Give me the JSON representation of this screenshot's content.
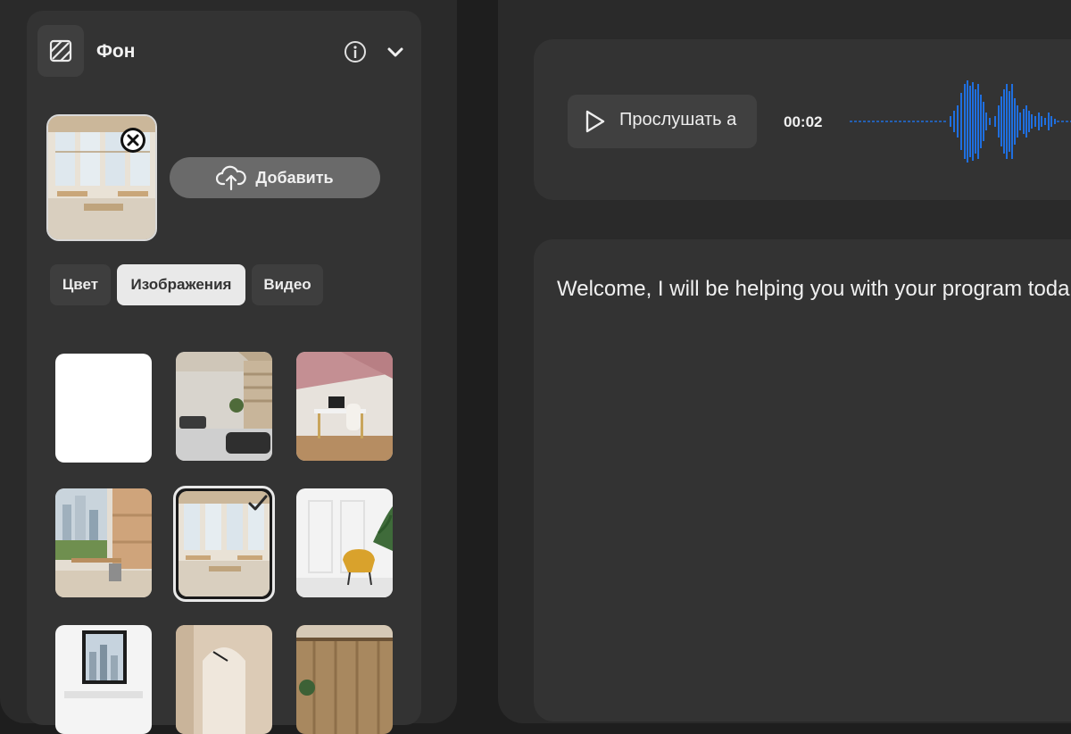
{
  "background_panel": {
    "title": "Фон",
    "preview_alt": "office-room-preview",
    "add_label": "Добавить",
    "tabs": [
      {
        "label": "Цвет",
        "active": false
      },
      {
        "label": "Изображения",
        "active": true
      },
      {
        "label": "Видео",
        "active": false
      }
    ],
    "images": [
      {
        "name": "plain-white",
        "selected": false
      },
      {
        "name": "lounge-office",
        "selected": false
      },
      {
        "name": "pink-wall-desk",
        "selected": false
      },
      {
        "name": "city-view-office",
        "selected": false
      },
      {
        "name": "bright-window-office",
        "selected": true
      },
      {
        "name": "yellow-chair-room",
        "selected": false
      },
      {
        "name": "skyline-window-room",
        "selected": false
      },
      {
        "name": "arched-hall",
        "selected": false
      },
      {
        "name": "wood-panel-room",
        "selected": false
      }
    ]
  },
  "audio": {
    "listen_label": "Прослушать а",
    "time": "00:02",
    "accent_color": "#1f6fe0"
  },
  "script": {
    "text": "Welcome, I will be helping you with your program toda"
  },
  "colors": {
    "page_bg": "#1e1e1e",
    "panel_bg": "#333333",
    "active_tab_bg": "#e9e9e9"
  }
}
